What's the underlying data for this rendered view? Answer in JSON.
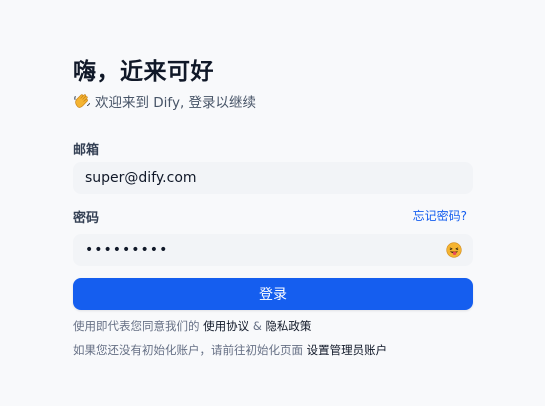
{
  "header": {
    "title": "嗨，近来可好",
    "subtitle": "欢迎来到 Dify, 登录以继续",
    "wave_icon": "waving-hand-icon"
  },
  "form": {
    "email_label": "邮箱",
    "email_value": "super@dify.com",
    "password_label": "密码",
    "forgot_password_link": "忘记密码?",
    "password_value": "•••••••••",
    "password_toggle_icon": "emoji-tongue-icon",
    "login_button": "登录"
  },
  "footer": {
    "terms_prefix": "使用即代表您同意我们的",
    "terms_link": "使用协议",
    "terms_and": "&",
    "privacy_link": "隐私政策",
    "init_prefix": "如果您还没有初始化账户，请前往初始化页面",
    "init_link": "设置管理员账户"
  },
  "colors": {
    "accent": "#155eef",
    "background": "#f8f9fb",
    "input_bg": "#f2f4f7"
  }
}
